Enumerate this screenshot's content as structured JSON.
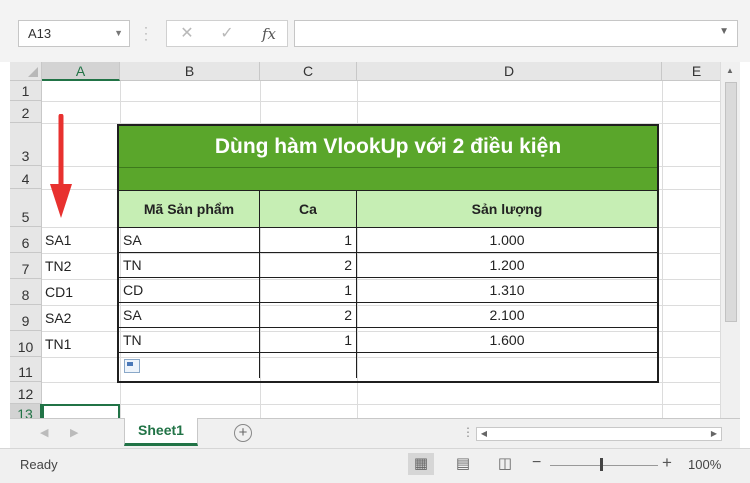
{
  "formula_bar": {
    "name_box": "A13",
    "fx_label": "fx",
    "cancel_glyph": "✕",
    "enter_glyph": "✓",
    "formula": ""
  },
  "columns": [
    "A",
    "B",
    "C",
    "D",
    "E"
  ],
  "rows": [
    "1",
    "2",
    "3",
    "4",
    "5",
    "6",
    "7",
    "8",
    "9",
    "10",
    "11",
    "12",
    "13"
  ],
  "column_a_values": [
    "SA1",
    "TN2",
    "CD1",
    "SA2",
    "TN1"
  ],
  "table": {
    "title": "Dùng hàm VlookUp với 2 điều kiện",
    "headers": [
      "Mã Sản phẩm",
      "Ca",
      "Sản lượng"
    ],
    "rows": [
      {
        "code": "SA",
        "shift": "1",
        "output": "1.000"
      },
      {
        "code": "TN",
        "shift": "2",
        "output": "1.200"
      },
      {
        "code": "CD",
        "shift": "1",
        "output": "1.310"
      },
      {
        "code": "SA",
        "shift": "2",
        "output": "2.100"
      },
      {
        "code": "TN",
        "shift": "1",
        "output": "1.600"
      }
    ],
    "title_color": "#5aa62b",
    "header_color": "#c6eeb4"
  },
  "annotation": {
    "arrow_color": "#e8312f",
    "icon": "down-arrow-icon"
  },
  "sheet_tabs": {
    "active": "Sheet1",
    "add_icon": "plus-circle-icon"
  },
  "status_bar": {
    "ready": "Ready",
    "zoom": "100%"
  }
}
